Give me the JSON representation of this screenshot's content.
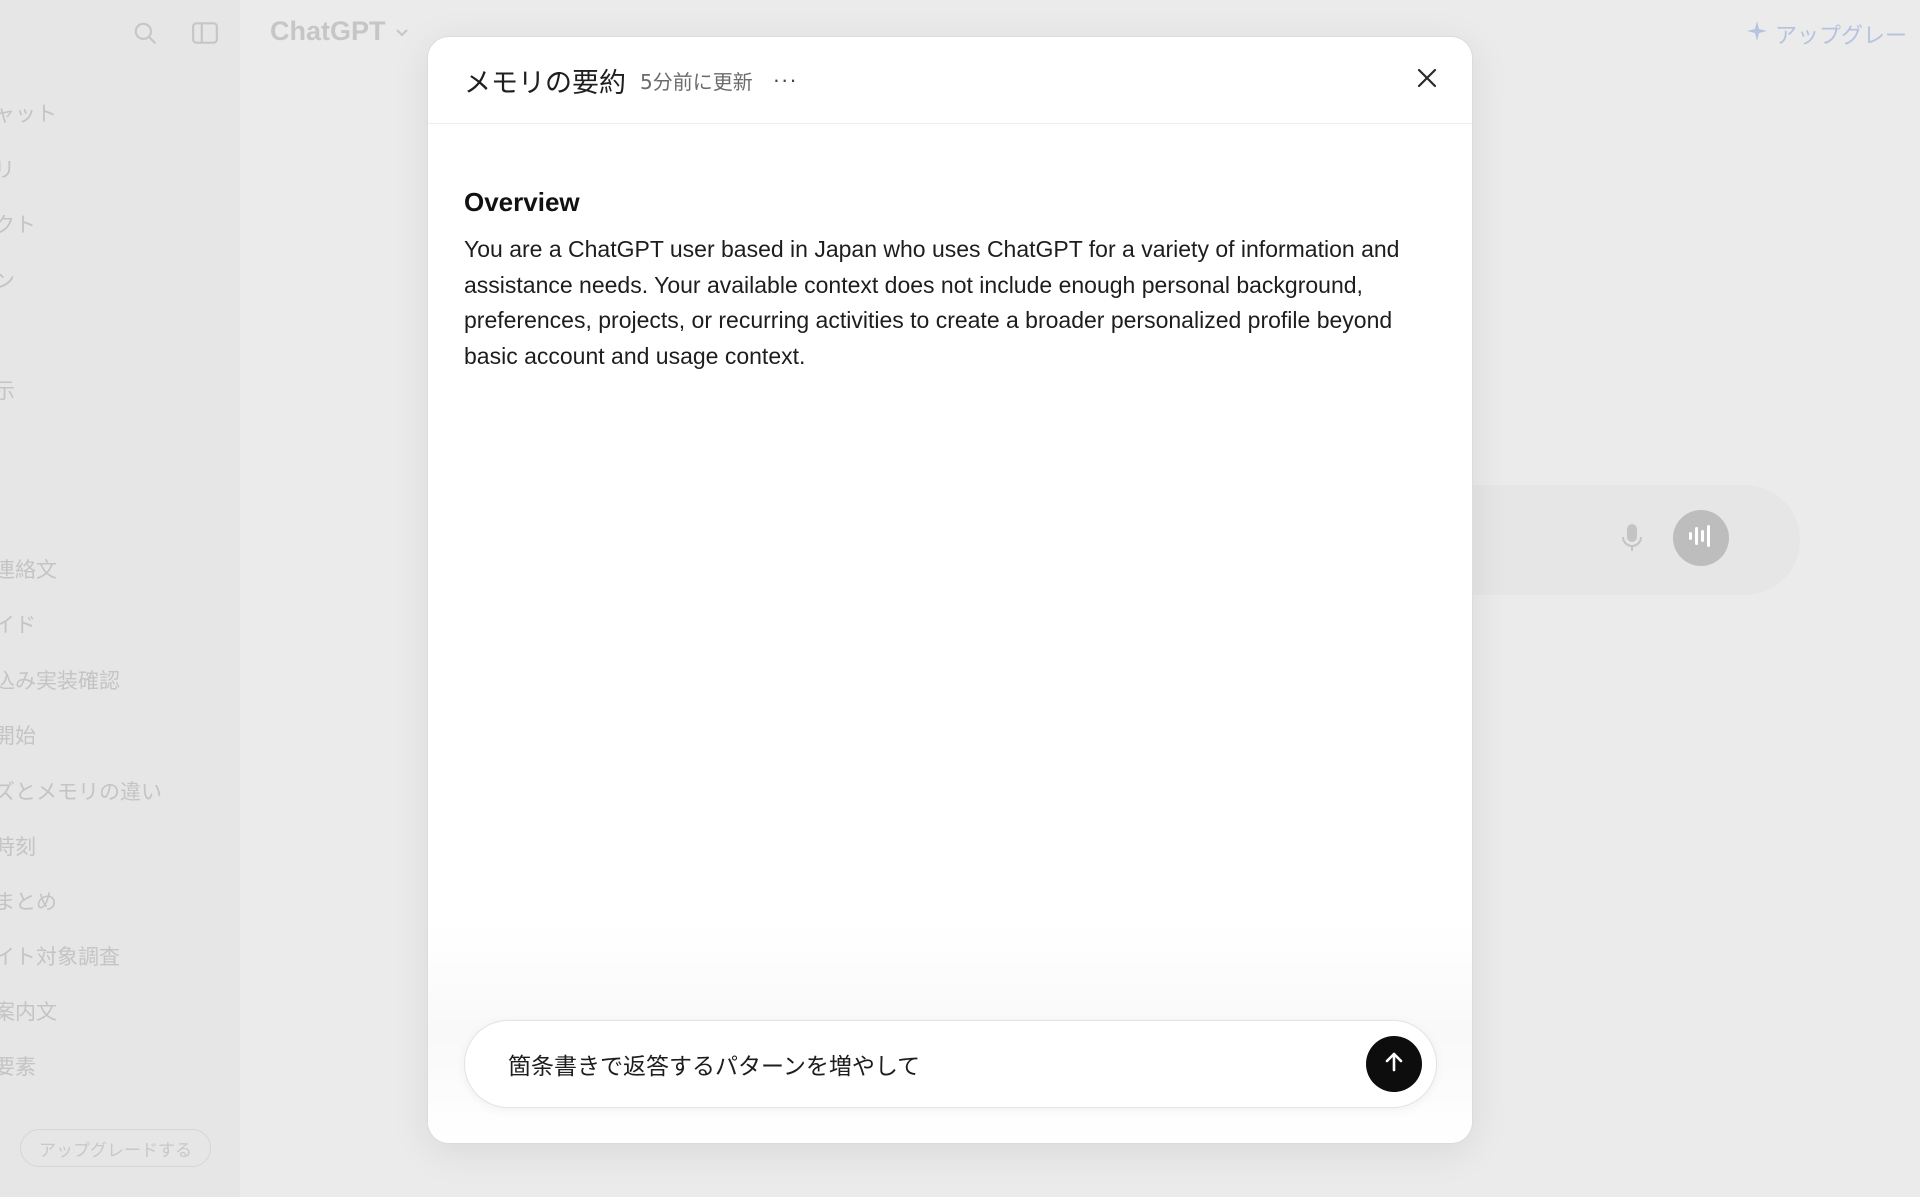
{
  "background": {
    "app_name": "ChatGPT",
    "top_upgrade_label": "アップグレー",
    "sidebar": {
      "items": [
        {
          "label": "ャット"
        },
        {
          "label": "リ"
        },
        {
          "label": "クト"
        },
        {
          "label": "ン"
        },
        {
          "label": "示"
        },
        {
          "label": "連絡文"
        },
        {
          "label": "イド"
        },
        {
          "label": "込み実装確認"
        },
        {
          "label": "開始"
        },
        {
          "label": "ズとメモリの違い"
        },
        {
          "label": "時刻"
        },
        {
          "label": "まとめ"
        },
        {
          "label": "イト対象調査"
        },
        {
          "label": "案内文"
        },
        {
          "label": "要素"
        }
      ],
      "upgrade_button_label": "アップグレードする"
    }
  },
  "modal": {
    "title": "メモリの要約",
    "updated": "5分前に更新",
    "more_label": "···",
    "section": {
      "heading": "Overview",
      "text": "You are a ChatGPT user based in Japan who uses ChatGPT for a variety of information and assistance needs. Your available context does not include enough personal background, preferences, projects, or recurring activities to create a broader personalized profile beyond basic account and usage context."
    },
    "input": {
      "value": "箇条書きで返答するパターンを増やして"
    }
  },
  "colors": {
    "accent": "#0d0d0d",
    "upgrade_blue": "#b5c3df"
  }
}
